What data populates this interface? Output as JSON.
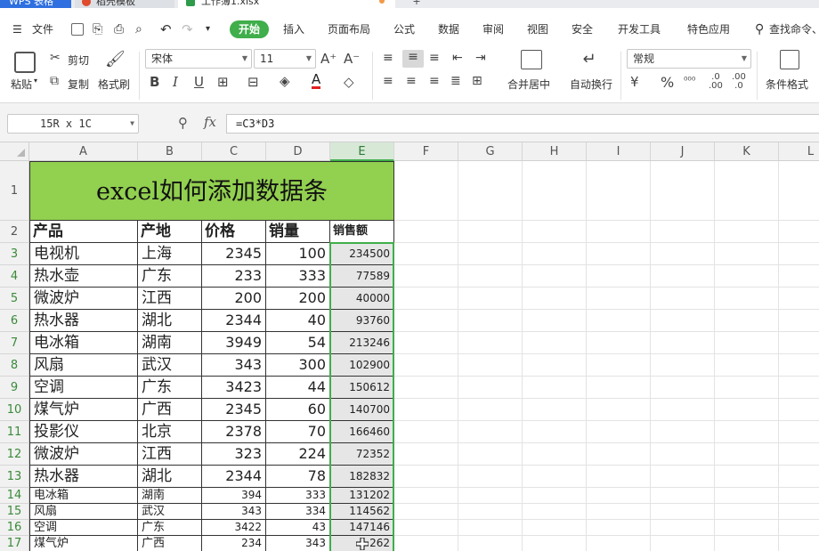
{
  "titlebar": {
    "app_name": "WPS 表格",
    "tab1": "稻壳模板",
    "tab2": "工作簿1.xlsx",
    "plus": "+"
  },
  "menu": {
    "file": "文件",
    "items": [
      "开始",
      "插入",
      "页面布局",
      "公式",
      "数据",
      "审阅",
      "视图",
      "安全",
      "开发工具",
      "特色应用"
    ],
    "search": "查找命令、"
  },
  "ribbon": {
    "paste": "粘贴",
    "cut": "剪切",
    "copy": "复制",
    "format_painter": "格式刷",
    "font_name": "宋体",
    "font_size": "11",
    "merge_center": "合并居中",
    "wrap_text": "自动换行",
    "number_format": "常规",
    "conditional_format": "条件格式"
  },
  "formula_bar": {
    "name_box": "15R x 1C",
    "fx": "fx",
    "formula": "=C3*D3"
  },
  "grid": {
    "columns": [
      "A",
      "B",
      "C",
      "D",
      "E",
      "F",
      "G",
      "H",
      "I",
      "J",
      "K",
      "L"
    ],
    "selected_column": "E",
    "title": "excel如何添加数据条",
    "headers": [
      "产品",
      "产地",
      "价格",
      "销量",
      "销售额"
    ],
    "rows": [
      {
        "row": "3",
        "product": "电视机",
        "origin": "上海",
        "price": "2345",
        "qty": "100",
        "sales": "234500"
      },
      {
        "row": "4",
        "product": "热水壶",
        "origin": "广东",
        "price": "233",
        "qty": "333",
        "sales": "77589"
      },
      {
        "row": "5",
        "product": "微波炉",
        "origin": "江西",
        "price": "200",
        "qty": "200",
        "sales": "40000"
      },
      {
        "row": "6",
        "product": "热水器",
        "origin": "湖北",
        "price": "2344",
        "qty": "40",
        "sales": "93760"
      },
      {
        "row": "7",
        "product": "电冰箱",
        "origin": "湖南",
        "price": "3949",
        "qty": "54",
        "sales": "213246"
      },
      {
        "row": "8",
        "product": "风扇",
        "origin": "武汉",
        "price": "343",
        "qty": "300",
        "sales": "102900"
      },
      {
        "row": "9",
        "product": "空调",
        "origin": "广东",
        "price": "3423",
        "qty": "44",
        "sales": "150612"
      },
      {
        "row": "10",
        "product": "煤气炉",
        "origin": "广西",
        "price": "2345",
        "qty": "60",
        "sales": "140700"
      },
      {
        "row": "11",
        "product": "投影仪",
        "origin": "北京",
        "price": "2378",
        "qty": "70",
        "sales": "166460"
      },
      {
        "row": "12",
        "product": "微波炉",
        "origin": "江西",
        "price": "323",
        "qty": "224",
        "sales": "72352"
      },
      {
        "row": "13",
        "product": "热水器",
        "origin": "湖北",
        "price": "2344",
        "qty": "78",
        "sales": "182832"
      },
      {
        "row": "14",
        "product": "电冰箱",
        "origin": "湖南",
        "price": "394",
        "qty": "333",
        "sales": "131202"
      },
      {
        "row": "15",
        "product": "风扇",
        "origin": "武汉",
        "price": "343",
        "qty": "334",
        "sales": "114562"
      },
      {
        "row": "16",
        "product": "空调",
        "origin": "广东",
        "price": "3422",
        "qty": "43",
        "sales": "147146"
      },
      {
        "row": "17",
        "product": "煤气炉",
        "origin": "广西",
        "price": "234",
        "qty": "343",
        "sales": "262"
      }
    ]
  },
  "colors": {
    "accent_green": "#3fae4b",
    "title_fill": "#92d050",
    "selection_fill": "#e6e6e6"
  }
}
